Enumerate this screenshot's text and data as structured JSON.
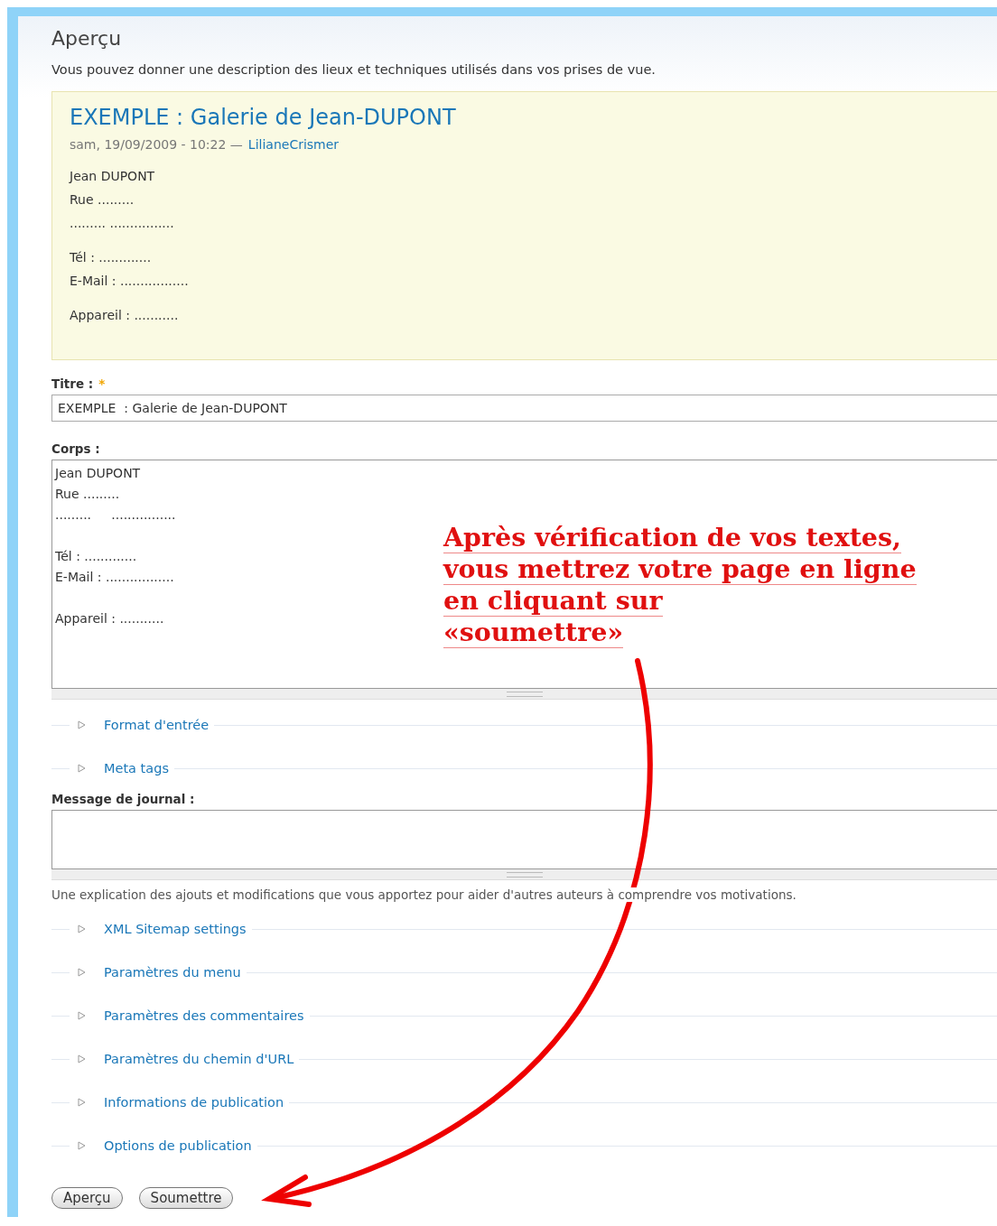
{
  "page": {
    "title": "Aperçu",
    "description": "Vous pouvez donner une description des lieux et techniques utilisés dans vos prises de vue."
  },
  "preview": {
    "title": "EXEMPLE : Galerie de Jean-DUPONT",
    "meta": "sam, 19/09/2009 - 10:22 —",
    "author": "LilianeCrismer",
    "paragraphs": [
      {
        "lines": [
          "Jean DUPONT",
          "Rue .........",
          "......... ................"
        ]
      },
      {
        "lines": [
          "Tél : .............",
          "E-Mail : ................."
        ]
      },
      {
        "lines": [
          "Appareil : ..........."
        ]
      }
    ]
  },
  "title_field": {
    "label": "Titre :",
    "required_mark": "*",
    "value": "EXEMPLE  : Galerie de Jean-DUPONT"
  },
  "body_field": {
    "label": "Corps :",
    "paragraphs": [
      {
        "lines": [
          "Jean DUPONT",
          "Rue .........",
          ".........     ................"
        ]
      },
      {
        "lines": [
          "Tél : .............",
          "E-Mail : ................."
        ]
      },
      {
        "lines": [
          "Appareil : ..........."
        ]
      }
    ]
  },
  "sections_top": [
    {
      "label": "Format d'entrée",
      "expanded": false
    },
    {
      "label": "Meta tags",
      "expanded": false
    }
  ],
  "log_field": {
    "label": "Message de journal :",
    "help": "Une explication des ajouts et modifications que vous apportez pour aider d'autres auteurs à comprendre vos motivations."
  },
  "sections_bottom": [
    {
      "label": "XML Sitemap settings",
      "expanded": false
    },
    {
      "label": "Paramètres du menu",
      "expanded": false
    },
    {
      "label": "Paramètres des commentaires",
      "expanded": false
    },
    {
      "label": "Paramètres du chemin d'URL",
      "expanded": false
    },
    {
      "label": "Informations de publication",
      "expanded": false
    },
    {
      "label": "Options de publication",
      "expanded": false
    }
  ],
  "buttons": [
    "Aperçu",
    "Soumettre"
  ],
  "annotation": {
    "lines": [
      "Après vérification de vos textes,",
      "vous mettrez votre page en ligne",
      "en cliquant sur",
      "«soumettre»"
    ]
  }
}
